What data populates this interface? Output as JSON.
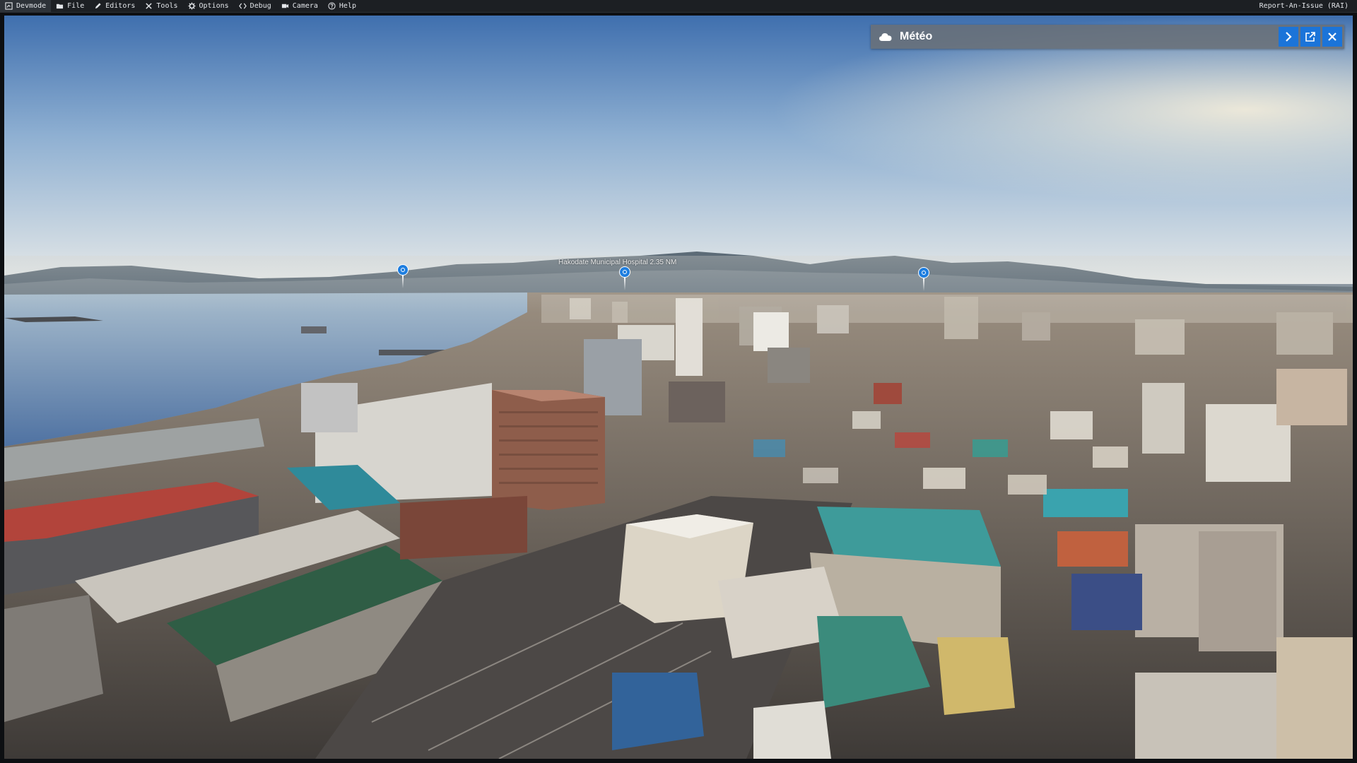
{
  "menu": {
    "items": [
      {
        "label": "Devmode",
        "icon": "devmode-icon"
      },
      {
        "label": "File",
        "icon": "folder-icon"
      },
      {
        "label": "Editors",
        "icon": "pencil-icon"
      },
      {
        "label": "Tools",
        "icon": "tools-icon"
      },
      {
        "label": "Options",
        "icon": "gear-icon"
      },
      {
        "label": "Debug",
        "icon": "code-icon"
      },
      {
        "label": "Camera",
        "icon": "camera-icon"
      },
      {
        "label": "Help",
        "icon": "help-icon"
      }
    ],
    "report_label": "Report-An-Issue (RAI)"
  },
  "meteo_panel": {
    "title": "Météo",
    "icon": "cloud-icon",
    "buttons": [
      "expand-arrow-icon",
      "popout-icon",
      "close-icon"
    ],
    "accent_color": "#1b74d9"
  },
  "poi": {
    "hospital_label": "Hakodate Municipal Hospital 2.35 NM"
  },
  "colors": {
    "menubar_bg": "#1c1f23",
    "sky_top": "#4f7db5",
    "sky_horizon": "#dfe6ea",
    "water": "#6f8fb4"
  }
}
